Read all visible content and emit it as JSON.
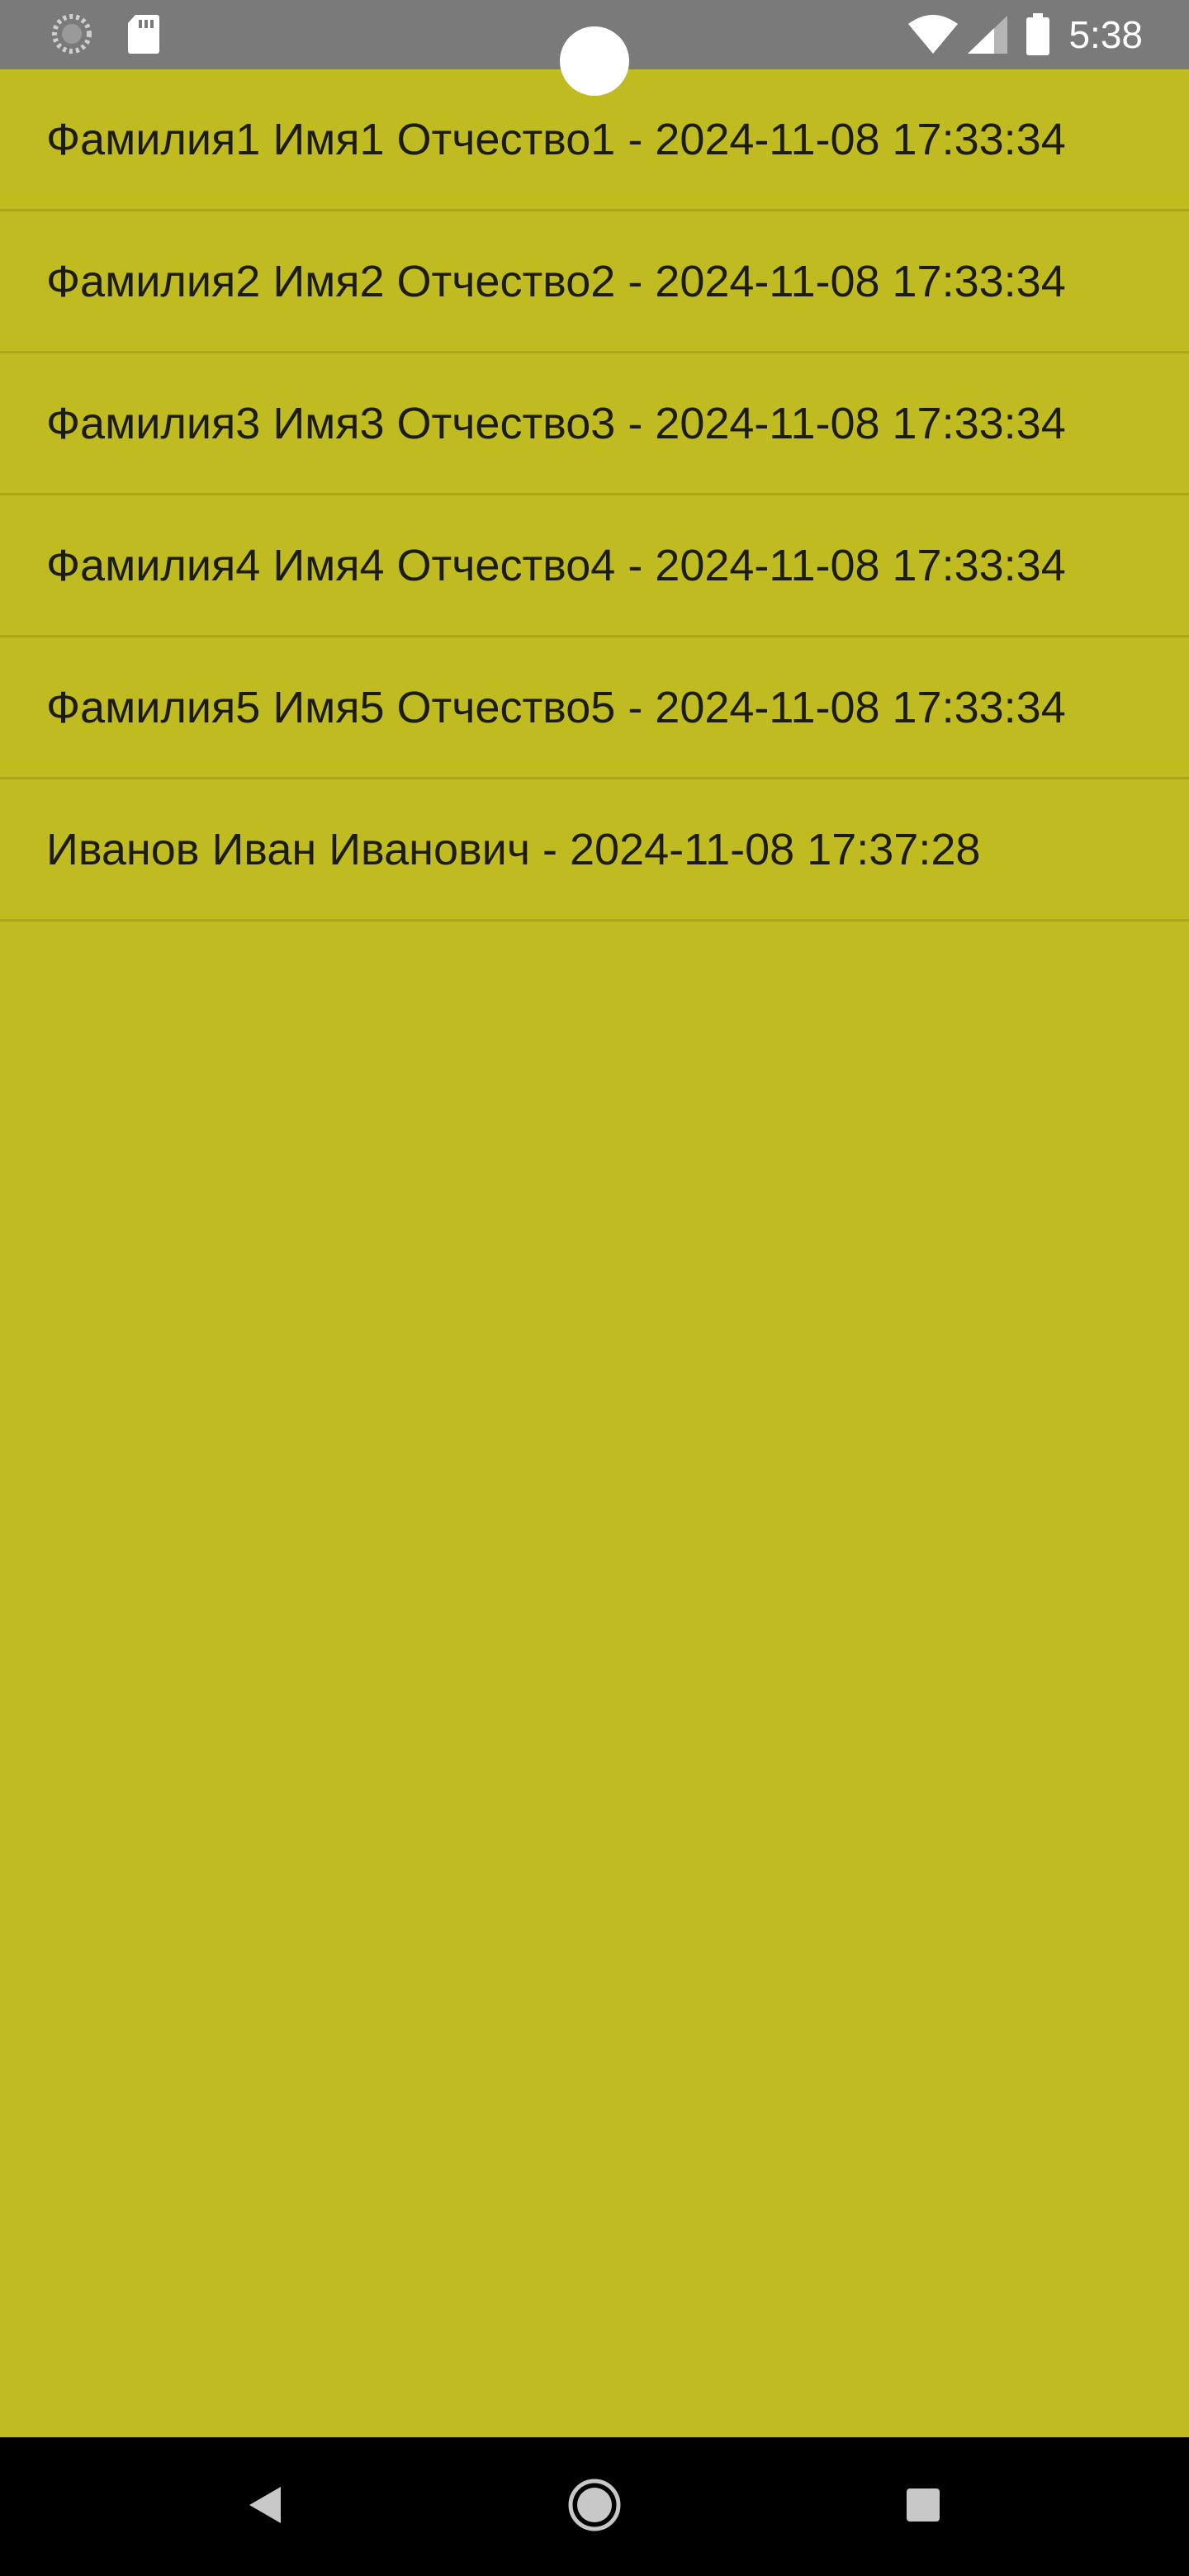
{
  "status_bar": {
    "time": "5:38",
    "icons_left": [
      "loading-icon",
      "sd-card-icon"
    ],
    "icons_right": [
      "wifi-icon",
      "cell-signal-icon",
      "battery-icon"
    ]
  },
  "list": {
    "items": [
      {
        "text": "Фамилия1 Имя1 Отчество1 - 2024-11-08 17:33:34"
      },
      {
        "text": "Фамилия2 Имя2 Отчество2 - 2024-11-08 17:33:34"
      },
      {
        "text": "Фамилия3 Имя3 Отчество3 - 2024-11-08 17:33:34"
      },
      {
        "text": "Фамилия4 Имя4 Отчество4 - 2024-11-08 17:33:34"
      },
      {
        "text": "Фамилия5 Имя5 Отчество5 - 2024-11-08 17:33:34"
      },
      {
        "text": "Иванов Иван Иванович - 2024-11-08 17:37:28"
      }
    ]
  },
  "nav_bar": {
    "buttons": [
      "back-icon",
      "home-icon",
      "recents-icon"
    ]
  },
  "colors": {
    "background": "#bfbb21",
    "status_bar": "#7a7a7a",
    "divider": "#a9a51f",
    "text": "#1c1c10",
    "nav_bar": "#000000"
  }
}
